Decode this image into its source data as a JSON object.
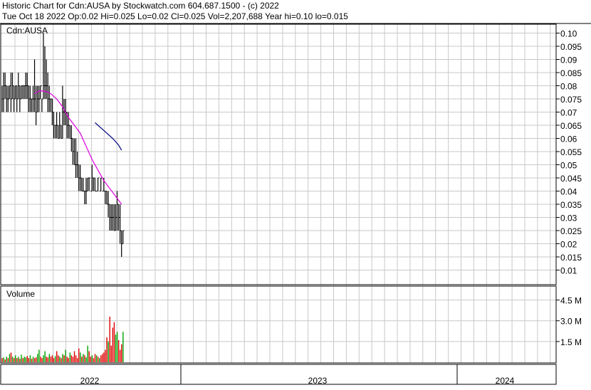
{
  "header": {
    "line1": "Historic Chart for Cdn:AUSA by Stockwatch.com 604.687.1500 - (c) 2022",
    "line2": "Tue Oct 18 2022  Op:0.02  Hi=0.025  Lo=0.02  Cl=0.025  Vol=2,207,688  Year hi=0.10  lo=0.015"
  },
  "colors": {
    "grid": "#c8c8c8",
    "price_bar": "#000000",
    "ma_short": "#e000e0",
    "ma_long": "#000080",
    "volume_up": "#00a000",
    "volume_down": "#e00000",
    "volume_flat": "#808080"
  },
  "chart_data": [
    {
      "type": "ohlc",
      "title": "Cdn:AUSA",
      "ylim": [
        0.005,
        0.105
      ],
      "yticks": [
        "0.10",
        "0.095",
        "0.09",
        "0.085",
        "0.08",
        "0.075",
        "0.07",
        "0.065",
        "0.06",
        "0.055",
        "0.05",
        "0.045",
        "0.04",
        "0.035",
        "0.03",
        "0.025",
        "0.02",
        "0.015",
        "0.01"
      ],
      "xticks": [
        "2022",
        "2023",
        "2024"
      ],
      "grid": true,
      "series": [
        {
          "kind": "price_bars",
          "high": [
            0.08,
            0.085,
            0.085,
            0.08,
            0.08,
            0.08,
            0.085,
            0.085,
            0.08,
            0.08,
            0.08,
            0.085,
            0.08,
            0.08,
            0.08,
            0.08,
            0.085,
            0.085,
            0.08,
            0.08,
            0.075,
            0.08,
            0.09,
            0.08,
            0.08,
            0.08,
            0.08,
            0.075,
            0.1,
            0.095,
            0.09,
            0.085,
            0.08,
            0.075,
            0.075,
            0.07,
            0.065,
            0.07,
            0.065,
            0.07,
            0.065,
            0.08,
            0.075,
            0.075,
            0.07,
            0.07,
            0.065,
            0.065,
            0.06,
            0.06,
            0.06,
            0.055,
            0.05,
            0.05,
            0.045,
            0.045,
            0.04,
            0.045,
            0.045,
            0.045,
            0.04,
            0.05,
            0.045,
            0.045,
            0.04,
            0.045,
            0.04,
            0.045,
            0.04,
            0.045,
            0.04,
            0.04,
            0.04,
            0.035,
            0.035,
            0.035,
            0.035,
            0.035,
            0.04,
            0.035,
            0.035,
            0.025,
            0.025
          ],
          "low": [
            0.07,
            0.07,
            0.075,
            0.07,
            0.07,
            0.075,
            0.07,
            0.075,
            0.07,
            0.075,
            0.07,
            0.075,
            0.07,
            0.075,
            0.075,
            0.075,
            0.075,
            0.075,
            0.07,
            0.07,
            0.07,
            0.07,
            0.07,
            0.065,
            0.07,
            0.07,
            0.075,
            0.07,
            0.075,
            0.075,
            0.075,
            0.07,
            0.07,
            0.07,
            0.065,
            0.06,
            0.06,
            0.06,
            0.06,
            0.06,
            0.06,
            0.06,
            0.065,
            0.065,
            0.06,
            0.06,
            0.06,
            0.055,
            0.05,
            0.05,
            0.045,
            0.045,
            0.04,
            0.04,
            0.04,
            0.04,
            0.035,
            0.035,
            0.04,
            0.04,
            0.04,
            0.04,
            0.04,
            0.04,
            0.04,
            0.04,
            0.04,
            0.04,
            0.04,
            0.04,
            0.035,
            0.035,
            0.03,
            0.025,
            0.025,
            0.025,
            0.025,
            0.025,
            0.025,
            0.025,
            0.02,
            0.015,
            0.02
          ],
          "close": [
            0.075,
            0.08,
            0.08,
            0.075,
            0.075,
            0.08,
            0.075,
            0.08,
            0.075,
            0.08,
            0.075,
            0.08,
            0.075,
            0.08,
            0.08,
            0.08,
            0.08,
            0.08,
            0.075,
            0.075,
            0.075,
            0.075,
            0.075,
            0.07,
            0.075,
            0.075,
            0.08,
            0.075,
            0.08,
            0.08,
            0.08,
            0.075,
            0.075,
            0.075,
            0.07,
            0.065,
            0.065,
            0.065,
            0.06,
            0.065,
            0.06,
            0.07,
            0.07,
            0.07,
            0.065,
            0.065,
            0.06,
            0.06,
            0.055,
            0.05,
            0.05,
            0.05,
            0.045,
            0.045,
            0.04,
            0.04,
            0.04,
            0.04,
            0.045,
            0.045,
            0.04,
            0.045,
            0.045,
            0.04,
            0.04,
            0.045,
            0.04,
            0.045,
            0.04,
            0.04,
            0.04,
            0.035,
            0.035,
            0.03,
            0.03,
            0.03,
            0.025,
            0.03,
            0.035,
            0.03,
            0.025,
            0.02,
            0.025
          ]
        },
        {
          "kind": "moving_average",
          "x": [
            22,
            25,
            29,
            33,
            37,
            41,
            45,
            49,
            53,
            57,
            61,
            65,
            69,
            73,
            77,
            81
          ],
          "values": [
            0.077,
            0.078,
            0.078,
            0.077,
            0.075,
            0.072,
            0.068,
            0.065,
            0.062,
            0.057,
            0.052,
            0.048,
            0.044,
            0.041,
            0.038,
            0.035
          ]
        },
        {
          "kind": "moving_average",
          "x": [
            63,
            67,
            71,
            75,
            79,
            81
          ],
          "values": [
            0.066,
            0.064,
            0.062,
            0.06,
            0.0575,
            0.0555
          ]
        }
      ]
    },
    {
      "type": "bar",
      "title": "Volume",
      "ylim": [
        0,
        5.2
      ],
      "yticks": [
        "4.5 M",
        "3.0 M",
        "1.5 M"
      ],
      "grid": true,
      "values": [
        0.3,
        0.35,
        0.2,
        0.4,
        0.3,
        0.6,
        0.7,
        0.4,
        0.3,
        0.5,
        0.3,
        0.4,
        0.25,
        0.55,
        0.3,
        0.4,
        0.35,
        0.45,
        0.3,
        0.5,
        0.25,
        0.4,
        0.3,
        0.35,
        0.6,
        0.9,
        0.4,
        0.3,
        0.5,
        0.8,
        0.4,
        0.35,
        0.6,
        0.4,
        0.5,
        0.3,
        0.45,
        0.8,
        0.5,
        0.4,
        0.3,
        0.6,
        0.5,
        0.9,
        0.4,
        0.3,
        0.7,
        0.5,
        0.4,
        0.8,
        0.5,
        0.3,
        1.0,
        0.7,
        0.4,
        0.6,
        0.5,
        0.35,
        1.2,
        0.8,
        0.4,
        0.5,
        0.3,
        0.6,
        0.5,
        0.4,
        0.3,
        0.5,
        0.6,
        0.7,
        0.9,
        1.8,
        1.5,
        3.3,
        1.2,
        2.5,
        2.9,
        2.0,
        2.2,
        1.6,
        0.9,
        1.3,
        2.2
      ],
      "directions": [
        "d",
        "u",
        "d",
        "u",
        "d",
        "u",
        "d",
        "u",
        "d",
        "u",
        "d",
        "u",
        "d",
        "u",
        "d",
        "u",
        "u",
        "d",
        "d",
        "u",
        "d",
        "u",
        "d",
        "d",
        "u",
        "u",
        "d",
        "d",
        "u",
        "u",
        "d",
        "d",
        "u",
        "d",
        "d",
        "d",
        "u",
        "d",
        "d",
        "u",
        "d",
        "u",
        "d",
        "u",
        "d",
        "d",
        "u",
        "d",
        "d",
        "d",
        "d",
        "d",
        "d",
        "u",
        "d",
        "u",
        "d",
        "u",
        "u",
        "d",
        "d",
        "u",
        "d",
        "d",
        "u",
        "d",
        "u",
        "d",
        "d",
        "d",
        "d",
        "d",
        "u",
        "d",
        "d",
        "d",
        "d",
        "u",
        "u",
        "d",
        "d",
        "d",
        "u"
      ]
    }
  ]
}
